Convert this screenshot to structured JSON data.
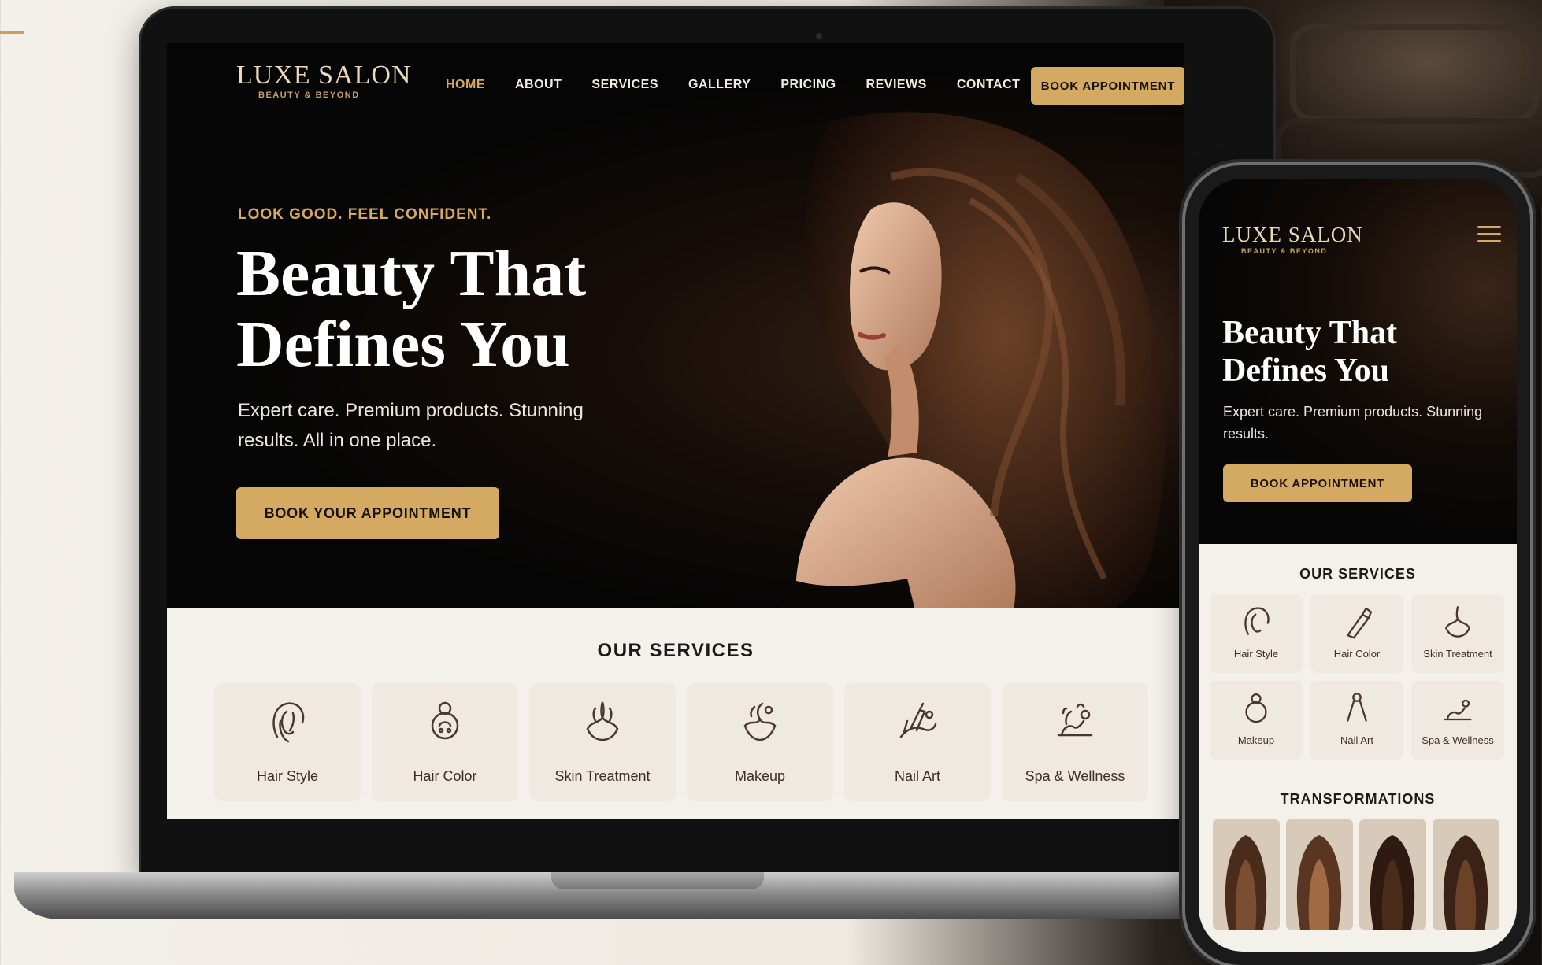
{
  "brand": {
    "name": "LUXE SALON",
    "tagline": "BEAUTY & BEYOND",
    "accent_color": "#d4a962",
    "dark_bg": "#050505",
    "light_bg": "#f4f0ea"
  },
  "desktop": {
    "nav": {
      "items": [
        {
          "label": "HOME",
          "active": true
        },
        {
          "label": "ABOUT",
          "active": false
        },
        {
          "label": "SERVICES",
          "active": false
        },
        {
          "label": "GALLERY",
          "active": false
        },
        {
          "label": "PRICING",
          "active": false
        },
        {
          "label": "REVIEWS",
          "active": false
        },
        {
          "label": "CONTACT",
          "active": false
        }
      ],
      "book_button": "BOOK APPOINTMENT"
    },
    "hero": {
      "tagline": "LOOK GOOD. FEEL CONFIDENT.",
      "title": "Beauty That Defines You",
      "subtitle": "Expert care. Premium products. Stunning results. All in one place.",
      "cta": "BOOK YOUR APPOINTMENT"
    },
    "services": {
      "title": "OUR SERVICES",
      "items": [
        {
          "label": "Hair Style",
          "icon": "hair-style-icon"
        },
        {
          "label": "Hair Color",
          "icon": "hair-color-icon"
        },
        {
          "label": "Skin Treatment",
          "icon": "skin-treatment-icon"
        },
        {
          "label": "Makeup",
          "icon": "makeup-icon"
        },
        {
          "label": "Nail Art",
          "icon": "nail-art-icon"
        },
        {
          "label": "Spa & Wellness",
          "icon": "spa-wellness-icon"
        }
      ]
    }
  },
  "mobile": {
    "hero": {
      "title": "Beauty That Defines You",
      "subtitle": "Expert care. Premium products. Stunning results.",
      "cta": "BOOK APPOINTMENT"
    },
    "services": {
      "title": "OUR SERVICES",
      "items": [
        {
          "label": "Hair Style"
        },
        {
          "label": "Hair Color"
        },
        {
          "label": "Skin Treatment"
        },
        {
          "label": "Makeup"
        },
        {
          "label": "Nail Art"
        },
        {
          "label": "Spa & Wellness"
        }
      ]
    },
    "transformations": {
      "title": "TRANSFORMATIONS",
      "count": 4
    }
  }
}
